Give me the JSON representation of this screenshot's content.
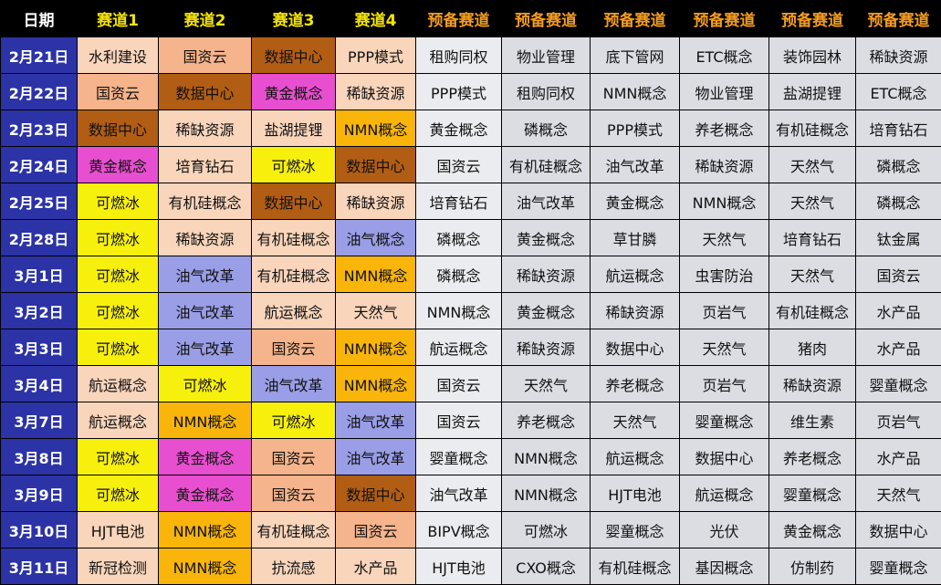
{
  "colors": {
    "header_bg": "#000000",
    "date_col_bg": "#2c33a6",
    "date_text": "#ffffff",
    "track_header_text": "#f5e400",
    "reserve_header_text": "#f39c1f",
    "date_header_text": "#ffffff",
    "reserve_bg": "#dcdde3",
    "first_reserve_bg": "#ebecef",
    "default_cell_bg": "#f9d5bb",
    "category_colors": {
      "水利建设": "#f9d5bb",
      "国资云": "#f5b48b",
      "数据中心": "#b25d14",
      "PPP模式": "#f9d5bb",
      "黄金概念": "#e84fd0",
      "稀缺资源": "#f9d5bb",
      "盐湖提锂": "#f9d5bb",
      "NMN概念": "#f9b509",
      "培育钻石": "#f9d5bb",
      "可燃冰": "#f7f00c",
      "有机硅概念": "#f9d5bb",
      "油气概念": "#9a9ee6",
      "油气改革": "#9a9ee6",
      "航运概念": "#f9d5bb",
      "天然气": "#f9d5bb",
      "HJT电池": "#f9d5bb",
      "新冠检测": "#f9d5bb",
      "抗流感": "#f9d5bb",
      "水产品": "#f9d5bb"
    }
  },
  "table": {
    "columns": [
      {
        "label": "日期",
        "kind": "date"
      },
      {
        "label": "赛道1",
        "kind": "track"
      },
      {
        "label": "赛道2",
        "kind": "track"
      },
      {
        "label": "赛道3",
        "kind": "track"
      },
      {
        "label": "赛道4",
        "kind": "track"
      },
      {
        "label": "预备赛道",
        "kind": "reserve"
      },
      {
        "label": "预备赛道",
        "kind": "reserve"
      },
      {
        "label": "预备赛道",
        "kind": "reserve"
      },
      {
        "label": "预备赛道",
        "kind": "reserve"
      },
      {
        "label": "预备赛道",
        "kind": "reserve"
      },
      {
        "label": "预备赛道",
        "kind": "reserve"
      }
    ],
    "rows": [
      {
        "date": "2月21日",
        "tracks": [
          "水利建设",
          "国资云",
          "数据中心",
          "PPP模式"
        ],
        "reserves": [
          "租购同权",
          "物业管理",
          "底下管网",
          "ETC概念",
          "装饰园林",
          "稀缺资源"
        ]
      },
      {
        "date": "2月22日",
        "tracks": [
          "国资云",
          "数据中心",
          "黄金概念",
          "稀缺资源"
        ],
        "reserves": [
          "PPP模式",
          "租购同权",
          "NMN概念",
          "物业管理",
          "盐湖提锂",
          "ETC概念"
        ]
      },
      {
        "date": "2月23日",
        "tracks": [
          "数据中心",
          "稀缺资源",
          "盐湖提锂",
          "NMN概念"
        ],
        "reserves": [
          "黄金概念",
          "磷概念",
          "PPP模式",
          "养老概念",
          "有机硅概念",
          "培育钻石"
        ]
      },
      {
        "date": "2月24日",
        "tracks": [
          "黄金概念",
          "培育钻石",
          "可燃冰",
          "数据中心"
        ],
        "reserves": [
          "国资云",
          "有机硅概念",
          "油气改革",
          "稀缺资源",
          "天然气",
          "磷概念"
        ]
      },
      {
        "date": "2月25日",
        "tracks": [
          "可燃冰",
          "有机硅概念",
          "数据中心",
          "稀缺资源"
        ],
        "reserves": [
          "培育钻石",
          "油气改革",
          "黄金概念",
          "NMN概念",
          "天然气",
          "磷概念"
        ]
      },
      {
        "date": "2月28日",
        "tracks": [
          "可燃冰",
          "稀缺资源",
          "有机硅概念",
          "油气概念"
        ],
        "reserves": [
          "磷概念",
          "黄金概念",
          "草甘膦",
          "天然气",
          "培育钻石",
          "钛金属"
        ]
      },
      {
        "date": "3月1日",
        "tracks": [
          "可燃冰",
          "油气改革",
          "有机硅概念",
          "NMN概念"
        ],
        "reserves": [
          "磷概念",
          "稀缺资源",
          "航运概念",
          "虫害防治",
          "天然气",
          "国资云"
        ]
      },
      {
        "date": "3月2日",
        "tracks": [
          "可燃冰",
          "油气改革",
          "航运概念",
          "天然气"
        ],
        "reserves": [
          "NMN概念",
          "黄金概念",
          "稀缺资源",
          "页岩气",
          "有机硅概念",
          "水产品"
        ]
      },
      {
        "date": "3月3日",
        "tracks": [
          "可燃冰",
          "油气改革",
          "国资云",
          "NMN概念"
        ],
        "reserves": [
          "航运概念",
          "稀缺资源",
          "数据中心",
          "天然气",
          "猪肉",
          "水产品"
        ]
      },
      {
        "date": "3月4日",
        "tracks": [
          "航运概念",
          "可燃冰",
          "油气改革",
          "NMN概念"
        ],
        "reserves": [
          "国资云",
          "天然气",
          "养老概念",
          "页岩气",
          "稀缺资源",
          "婴童概念"
        ]
      },
      {
        "date": "3月7日",
        "tracks": [
          "航运概念",
          "NMN概念",
          "可燃冰",
          "油气改革"
        ],
        "reserves": [
          "国资云",
          "养老概念",
          "天然气",
          "婴童概念",
          "维生素",
          "页岩气"
        ]
      },
      {
        "date": "3月8日",
        "tracks": [
          "可燃冰",
          "黄金概念",
          "国资云",
          "油气改革"
        ],
        "reserves": [
          "婴童概念",
          "NMN概念",
          "航运概念",
          "数据中心",
          "养老概念",
          "水产品"
        ]
      },
      {
        "date": "3月9日",
        "tracks": [
          "可燃冰",
          "黄金概念",
          "国资云",
          "数据中心"
        ],
        "reserves": [
          "油气改革",
          "NMN概念",
          "HJT电池",
          "航运概念",
          "婴童概念",
          "天然气"
        ]
      },
      {
        "date": "3月10日",
        "tracks": [
          "HJT电池",
          "NMN概念",
          "有机硅概念",
          "国资云"
        ],
        "reserves": [
          "BIPV概念",
          "可燃冰",
          "婴童概念",
          "光伏",
          "黄金概念",
          "数据中心"
        ]
      },
      {
        "date": "3月11日",
        "tracks": [
          "新冠检测",
          "NMN概念",
          "抗流感",
          "水产品"
        ],
        "reserves": [
          "HJT电池",
          "CXO概念",
          "有机硅概念",
          "基因概念",
          "仿制药",
          "婴童概念"
        ]
      }
    ]
  }
}
